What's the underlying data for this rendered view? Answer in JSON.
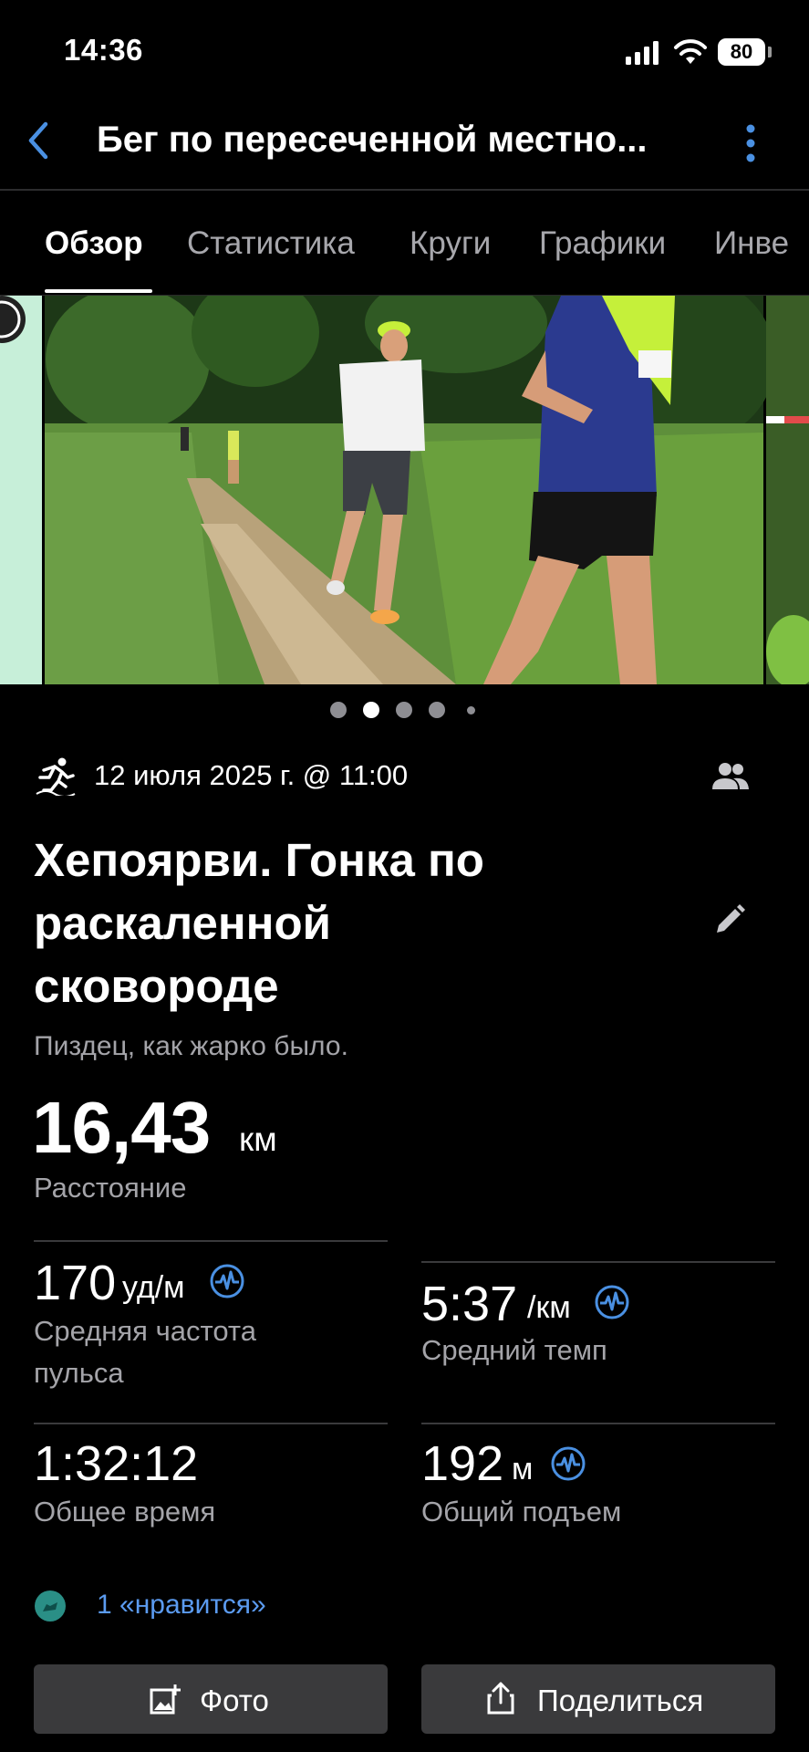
{
  "status_bar": {
    "time": "14:36",
    "battery": "80"
  },
  "header": {
    "title": "Бег по пересеченной местно...",
    "back_icon": "chevron-left-icon",
    "menu_icon": "more-vertical-icon"
  },
  "tabs": [
    {
      "label": "Обзор",
      "active": true
    },
    {
      "label": "Статистика",
      "active": false
    },
    {
      "label": "Круги",
      "active": false
    },
    {
      "label": "Графики",
      "active": false
    },
    {
      "label": "Инве",
      "active": false
    }
  ],
  "photos": {
    "count": 5,
    "active_index": 1
  },
  "activity": {
    "date": "12 июля 2025 г. @ 11:00",
    "title": "Хепоярви. Гонка по раскаленной сковороде",
    "description": "Пиздец, как жарко было.",
    "distance_value": "16,43",
    "distance_unit": "км",
    "distance_label": "Расстояние"
  },
  "stats": {
    "avg_hr": {
      "value": "170",
      "unit": "уд/м",
      "label": "Средняя частота пульса"
    },
    "avg_pace": {
      "value": "5:37",
      "unit": "/км",
      "label": "Средний темп"
    },
    "total_time": {
      "value": "1:32:12",
      "label": "Общее время"
    },
    "total_ascent": {
      "value": "192",
      "unit": "м",
      "label": "Общий подъем"
    }
  },
  "likes": "1 «нравится»",
  "buttons": {
    "photo": "Фото",
    "share": "Поделиться"
  },
  "colors": {
    "accent": "#4a90e2",
    "link": "#5b9bf0",
    "button_bg": "#3a3a3c"
  }
}
